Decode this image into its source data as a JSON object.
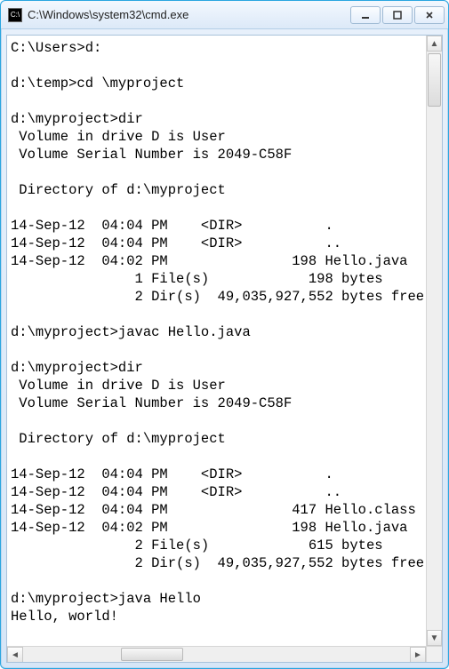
{
  "window": {
    "title": "C:\\Windows\\system32\\cmd.exe"
  },
  "console": {
    "lines": [
      "C:\\Users>d:",
      "",
      "d:\\temp>cd \\myproject",
      "",
      "d:\\myproject>dir",
      " Volume in drive D is User",
      " Volume Serial Number is 2049-C58F",
      "",
      " Directory of d:\\myproject",
      "",
      "14-Sep-12  04:04 PM    <DIR>          .",
      "14-Sep-12  04:04 PM    <DIR>          ..",
      "14-Sep-12  04:02 PM               198 Hello.java",
      "               1 File(s)            198 bytes",
      "               2 Dir(s)  49,035,927,552 bytes free",
      "",
      "d:\\myproject>javac Hello.java",
      "",
      "d:\\myproject>dir",
      " Volume in drive D is User",
      " Volume Serial Number is 2049-C58F",
      "",
      " Directory of d:\\myproject",
      "",
      "14-Sep-12  04:04 PM    <DIR>          .",
      "14-Sep-12  04:04 PM    <DIR>          ..",
      "14-Sep-12  04:04 PM               417 Hello.class",
      "14-Sep-12  04:02 PM               198 Hello.java",
      "               2 File(s)            615 bytes",
      "               2 Dir(s)  49,035,927,552 bytes free",
      "",
      "d:\\myproject>java Hello",
      "Hello, world!",
      ""
    ]
  }
}
